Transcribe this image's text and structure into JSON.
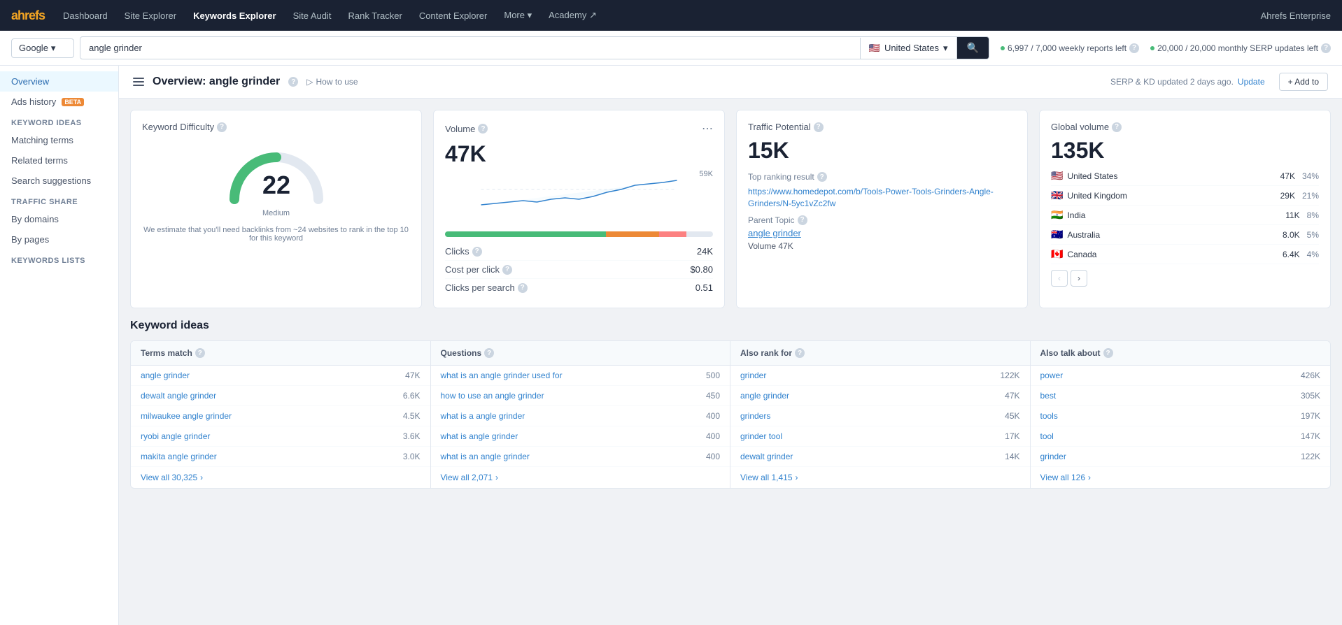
{
  "nav": {
    "logo": "ahrefs",
    "items": [
      {
        "label": "Dashboard",
        "active": false
      },
      {
        "label": "Site Explorer",
        "active": false
      },
      {
        "label": "Keywords Explorer",
        "active": true
      },
      {
        "label": "Site Audit",
        "active": false
      },
      {
        "label": "Rank Tracker",
        "active": false
      },
      {
        "label": "Content Explorer",
        "active": false
      },
      {
        "label": "More",
        "active": false,
        "dropdown": true
      },
      {
        "label": "Academy",
        "active": false,
        "external": true
      }
    ],
    "enterprise_label": "Ahrefs Enterprise"
  },
  "search": {
    "engine": "Google",
    "query": "angle grinder",
    "location": "United States",
    "reports_weekly": "6,997 / 7,000 weekly reports left",
    "reports_monthly": "20,000 / 20,000 monthly SERP updates left"
  },
  "header": {
    "title": "Overview: angle grinder",
    "how_to_use": "How to use",
    "update_notice": "SERP & KD updated 2 days ago.",
    "update_link": "Update",
    "add_to_label": "+ Add to"
  },
  "sidebar": {
    "overview_label": "Overview",
    "ads_history_label": "Ads history",
    "ads_history_badge": "BETA",
    "keyword_ideas_label": "Keyword ideas",
    "matching_terms_label": "Matching terms",
    "related_terms_label": "Related terms",
    "search_suggestions_label": "Search suggestions",
    "traffic_share_label": "Traffic share",
    "by_domains_label": "By domains",
    "by_pages_label": "By pages",
    "keywords_lists_label": "Keywords lists"
  },
  "keyword_difficulty": {
    "label": "Keyword Difficulty",
    "value": "22",
    "grade": "Medium",
    "note": "We estimate that you'll need backlinks from ~24 websites to rank in the top 10 for this keyword",
    "gauge_pct": 22
  },
  "volume": {
    "label": "Volume",
    "value": "47K",
    "max_label": "59K",
    "clicks_label": "Clicks",
    "clicks_value": "24K",
    "cpc_label": "Cost per click",
    "cpc_value": "$0.80",
    "cps_label": "Clicks per search",
    "cps_value": "0.51"
  },
  "traffic_potential": {
    "label": "Traffic Potential",
    "value": "15K",
    "top_ranking_label": "Top ranking result",
    "top_ranking_url": "https://www.homedepot.com/b/Tools-Power-Tools-Grinders-Angle-Grinders/N-5yc1vZc2fw",
    "parent_topic_label": "Parent Topic",
    "parent_topic_value": "angle grinder",
    "volume_label": "Volume",
    "volume_value": "47K"
  },
  "global_volume": {
    "label": "Global volume",
    "value": "135K",
    "countries": [
      {
        "flag": "🇺🇸",
        "name": "United States",
        "vol": "47K",
        "pct": "34%",
        "bar": 34
      },
      {
        "flag": "🇬🇧",
        "name": "United Kingdom",
        "vol": "29K",
        "pct": "21%",
        "bar": 21
      },
      {
        "flag": "🇮🇳",
        "name": "India",
        "vol": "11K",
        "pct": "8%",
        "bar": 8
      },
      {
        "flag": "🇦🇺",
        "name": "Australia",
        "vol": "8.0K",
        "pct": "5%",
        "bar": 5
      },
      {
        "flag": "🇨🇦",
        "name": "Canada",
        "vol": "6.4K",
        "pct": "4%",
        "bar": 4
      }
    ]
  },
  "keyword_ideas": {
    "section_label": "Keyword ideas",
    "columns": [
      {
        "header": "Terms match",
        "rows": [
          {
            "term": "angle grinder",
            "val": "47K"
          },
          {
            "term": "dewalt angle grinder",
            "val": "6.6K"
          },
          {
            "term": "milwaukee angle grinder",
            "val": "4.5K"
          },
          {
            "term": "ryobi angle grinder",
            "val": "3.6K"
          },
          {
            "term": "makita angle grinder",
            "val": "3.0K"
          }
        ],
        "view_all_label": "View all",
        "view_all_count": "30,325"
      },
      {
        "header": "Questions",
        "rows": [
          {
            "term": "what is an angle grinder used for",
            "val": "500"
          },
          {
            "term": "how to use an angle grinder",
            "val": "450"
          },
          {
            "term": "what is a angle grinder",
            "val": "400"
          },
          {
            "term": "what is angle grinder",
            "val": "400"
          },
          {
            "term": "what is an angle grinder",
            "val": "400"
          }
        ],
        "view_all_label": "View all",
        "view_all_count": "2,071"
      },
      {
        "header": "Also rank for",
        "rows": [
          {
            "term": "grinder",
            "val": "122K"
          },
          {
            "term": "angle grinder",
            "val": "47K"
          },
          {
            "term": "grinders",
            "val": "45K"
          },
          {
            "term": "grinder tool",
            "val": "17K"
          },
          {
            "term": "dewalt grinder",
            "val": "14K"
          }
        ],
        "view_all_label": "View all",
        "view_all_count": "1,415"
      },
      {
        "header": "Also talk about",
        "rows": [
          {
            "term": "power",
            "val": "426K"
          },
          {
            "term": "best",
            "val": "305K"
          },
          {
            "term": "tools",
            "val": "197K"
          },
          {
            "term": "tool",
            "val": "147K"
          },
          {
            "term": "grinder",
            "val": "122K"
          }
        ],
        "view_all_label": "View all",
        "view_all_count": "126"
      }
    ]
  }
}
